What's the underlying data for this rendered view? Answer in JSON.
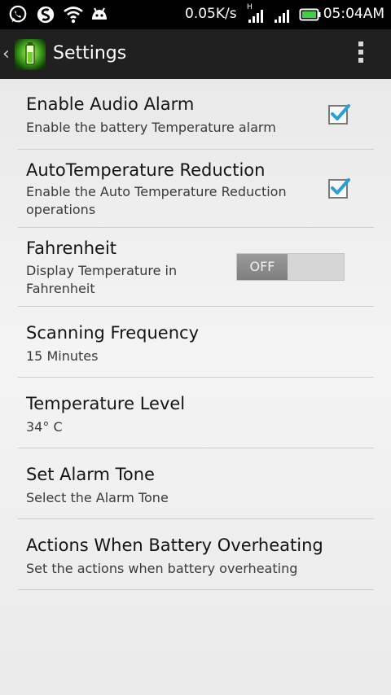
{
  "status_bar": {
    "speed": "0.05K/s",
    "time": "05:04AM",
    "icons": [
      "whatsapp-icon",
      "sync-icon",
      "wifi-icon",
      "android-debug-icon",
      "signal-h-icon",
      "signal-icon",
      "battery-icon"
    ],
    "network_type": "H"
  },
  "action_bar": {
    "title": "Settings"
  },
  "preferences": [
    {
      "title": "Enable Audio Alarm",
      "summary": "Enable the battery Temperature alarm",
      "control": "checkbox",
      "checked": true
    },
    {
      "title": "AutoTemperature Reduction",
      "summary": "Enable the Auto Temperature Reduction operations",
      "control": "checkbox",
      "checked": true
    },
    {
      "title": "Fahrenheit",
      "summary": "Display Temperature in Fahrenheit",
      "control": "switch",
      "switch_label": "OFF"
    },
    {
      "title": "Scanning Frequency",
      "summary": "15 Minutes"
    },
    {
      "title": "Temperature Level",
      "summary": "34° C"
    },
    {
      "title": "Set Alarm Tone",
      "summary": "Select the Alarm Tone"
    },
    {
      "title": "Actions When Battery Overheating",
      "summary": "Set the actions when battery overheating"
    }
  ],
  "colors": {
    "checkmark": "#2a9fd6",
    "battery": "#3fd13f"
  }
}
